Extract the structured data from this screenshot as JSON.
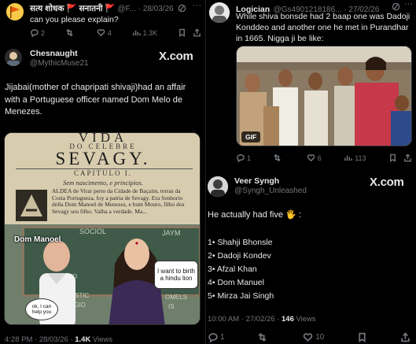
{
  "left": {
    "top_reply": {
      "name": "सत्य शोधक 🚩 सनातनी 🚩",
      "handle": "@F...",
      "date": "· 28/03/26",
      "text": "can you please explain?",
      "replies": "2",
      "retweets": "",
      "likes": "4",
      "views": "1.3K"
    },
    "quote": {
      "name": "Chesnaught",
      "handle": "@MythicMuse21",
      "brand": "X.com",
      "text": "Jijabai(mother of chapripati shivaji)had an affair with a Portuguese officer named Dom Melo de Menezes.",
      "book": {
        "line1": "VIDA",
        "line2": "DO CELEBRE",
        "line3": "SEVAGY.",
        "line4": "CAPITULO I.",
        "line5": "Sem nascimento, e principios.",
        "para": "ALDEA de Virar perto da Cidade de Baçaim, terras da Costa Portugueza, foy a patria de Sevagy. Era Senhorio della Dom Manoel de Menezes, e hum Mouro, filho dos Sevagy seu filho. Valha a verdade. Ma..."
      },
      "meme": {
        "label_teacher": "Dom Manoel",
        "bubble_left": "ok, I can help you",
        "bubble_right": "I want to birth a hindu lion",
        "board_words": [
          "SOCIOL",
          "JAYM",
          "DO",
          "ES",
          "TISTIC",
          "IGIO",
          "OMELS",
          "IS"
        ]
      },
      "footer_time": "4:28 PM · 28/03/26 ·",
      "footer_views": "1.4K",
      "footer_views_label": "Views"
    }
  },
  "right": {
    "top_reply": {
      "name": "Logician",
      "handle": "@Gs4901218186... · 27/02/26",
      "text": "While shiva bonsde had 2 baap one was Dadoji Konddeo and another one he met in Purandhar in 1665. Nigga ji be like:",
      "gif_label": "GIF",
      "replies": "1",
      "retweets": "",
      "likes": "6",
      "views": "113"
    },
    "quote": {
      "name": "Veer Syngh",
      "handle": "@Syngh_Unleashed",
      "brand": "X.com",
      "intro": "He actually had five 🖐 :",
      "list": [
        "Shahji Bhonsle",
        "Dadoji Kondev",
        "Afzal Khan",
        "Dom Manuel",
        "Mirza Jai Singh"
      ],
      "list_numbers": [
        "1•",
        "2•",
        "3•",
        "4•",
        "5•"
      ],
      "footer_time": "10:00 AM · 27/02/26 ·",
      "footer_views": "146",
      "footer_views_label": "Views",
      "replies": "1",
      "retweets": "",
      "likes": "10",
      "views": ""
    }
  },
  "icons": {
    "reply": "reply-icon",
    "retweet": "retweet-icon",
    "like": "heart-icon",
    "views": "views-icon",
    "bookmark": "bookmark-icon",
    "share": "share-icon",
    "grok": "grok-icon"
  },
  "colors": {
    "background": "#000000",
    "text": "#e7e9ea",
    "muted": "#71767b",
    "border": "#2f3336"
  }
}
